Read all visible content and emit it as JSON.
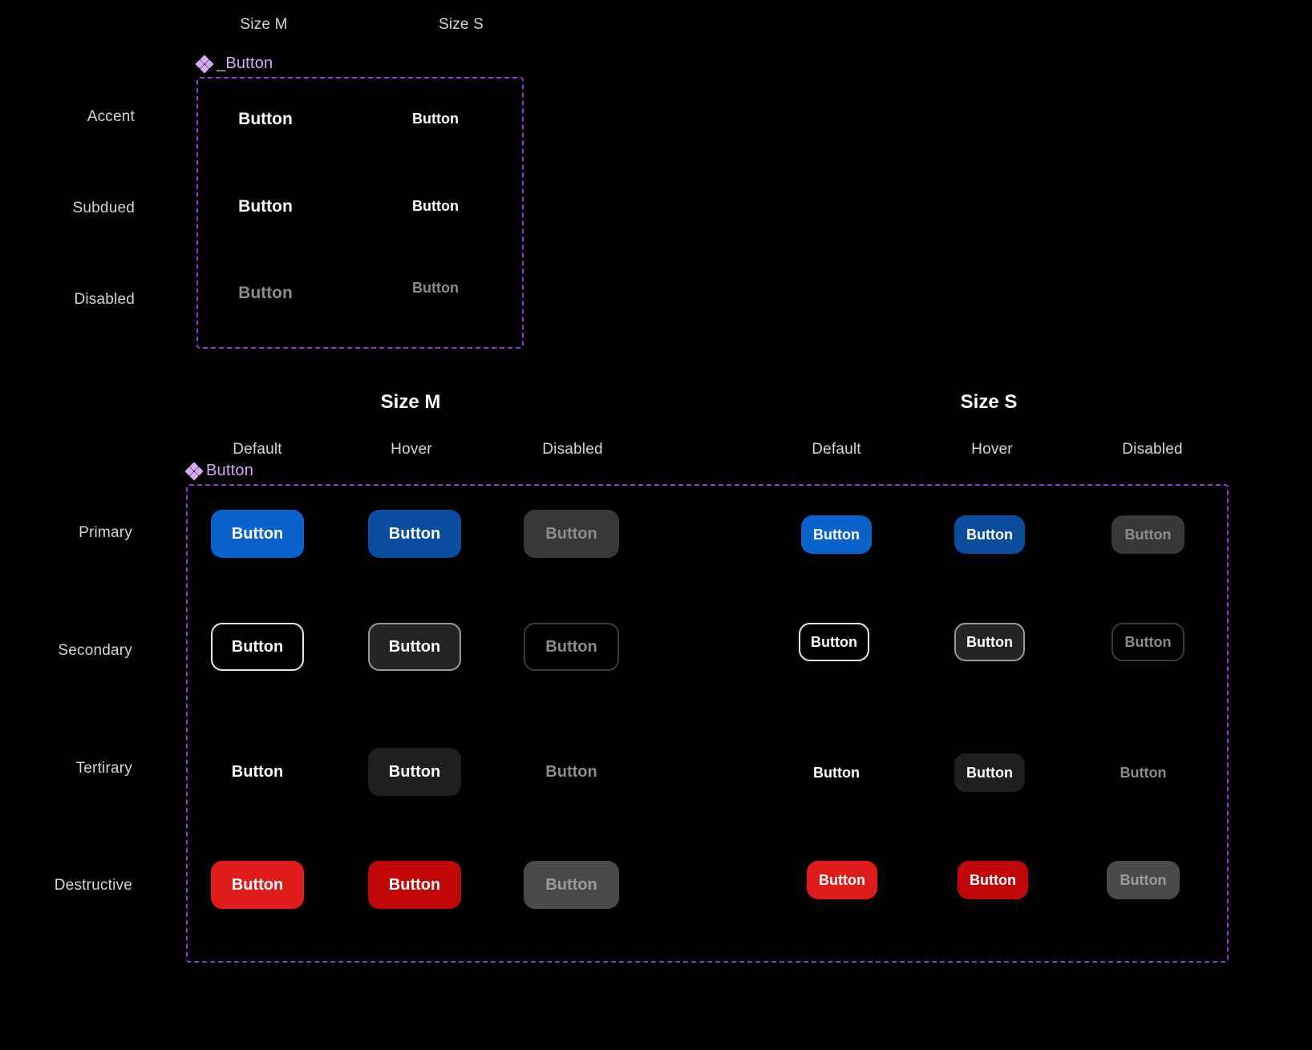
{
  "page": {
    "background": "#000000",
    "accent_purple": "#8b3dd6",
    "component_label_color": "#d7a8f5"
  },
  "top_section": {
    "component_name": "_Button",
    "component_icon": "figma-component-diamond-icon",
    "size_headers": [
      {
        "label": "Size M"
      },
      {
        "label": "Size S"
      }
    ],
    "row_labels": [
      {
        "label": "Accent"
      },
      {
        "label": "Subdued"
      },
      {
        "label": "Disabled"
      }
    ],
    "cells": [
      {
        "row": "Accent",
        "size": "Size M",
        "label": "Button",
        "state": "accent"
      },
      {
        "row": "Accent",
        "size": "Size S",
        "label": "Button",
        "state": "accent"
      },
      {
        "row": "Subdued",
        "size": "Size M",
        "label": "Button",
        "state": "subdued"
      },
      {
        "row": "Subdued",
        "size": "Size S",
        "label": "Button",
        "state": "subdued"
      },
      {
        "row": "Disabled",
        "size": "Size M",
        "label": "Button",
        "state": "disabled"
      },
      {
        "row": "Disabled",
        "size": "Size S",
        "label": "Button",
        "state": "disabled"
      }
    ]
  },
  "bottom_section": {
    "component_name": "Button",
    "component_icon": "figma-component-diamond-icon",
    "size_groups": [
      {
        "title": "Size M",
        "states": [
          "Default",
          "Hover",
          "Disabled"
        ]
      },
      {
        "title": "Size S",
        "states": [
          "Default",
          "Hover",
          "Disabled"
        ]
      }
    ],
    "state_headers": [
      "Default",
      "Hover",
      "Disabled",
      "Default",
      "Hover",
      "Disabled"
    ],
    "row_labels": [
      {
        "label": "Primary"
      },
      {
        "label": "Secondary"
      },
      {
        "label": "Tertirary"
      },
      {
        "label": "Destructive"
      }
    ],
    "button_label": "Button",
    "cells": [
      {
        "row": "Primary",
        "size": "Size M",
        "state": "Default",
        "label": "Button",
        "fill": "#0a63cc",
        "text": "#ffffff"
      },
      {
        "row": "Primary",
        "size": "Size M",
        "state": "Hover",
        "label": "Button",
        "fill": "#0a4c9e",
        "text": "#ffffff"
      },
      {
        "row": "Primary",
        "size": "Size M",
        "state": "Disabled",
        "label": "Button",
        "fill": "#383838",
        "text": "#8c8c8c"
      },
      {
        "row": "Primary",
        "size": "Size S",
        "state": "Default",
        "label": "Button",
        "fill": "#0a63cc",
        "text": "#ffffff"
      },
      {
        "row": "Primary",
        "size": "Size S",
        "state": "Hover",
        "label": "Button",
        "fill": "#0a4c9e",
        "text": "#ffffff"
      },
      {
        "row": "Primary",
        "size": "Size S",
        "state": "Disabled",
        "label": "Button",
        "fill": "#383838",
        "text": "#8c8c8c"
      },
      {
        "row": "Secondary",
        "size": "Size M",
        "state": "Default",
        "label": "Button",
        "fill": "transparent",
        "text": "#ffffff",
        "border": "#e8e8e8"
      },
      {
        "row": "Secondary",
        "size": "Size M",
        "state": "Hover",
        "label": "Button",
        "fill": "#242424",
        "text": "#ffffff",
        "border": "#9a9a9a"
      },
      {
        "row": "Secondary",
        "size": "Size M",
        "state": "Disabled",
        "label": "Button",
        "fill": "transparent",
        "text": "#8c8c8c",
        "border": "#3a3a3a"
      },
      {
        "row": "Secondary",
        "size": "Size S",
        "state": "Default",
        "label": "Button",
        "fill": "transparent",
        "text": "#ffffff",
        "border": "#e8e8e8"
      },
      {
        "row": "Secondary",
        "size": "Size S",
        "state": "Hover",
        "label": "Button",
        "fill": "#242424",
        "text": "#ffffff",
        "border": "#9a9a9a"
      },
      {
        "row": "Secondary",
        "size": "Size S",
        "state": "Disabled",
        "label": "Button",
        "fill": "transparent",
        "text": "#8c8c8c",
        "border": "#3a3a3a"
      },
      {
        "row": "Tertirary",
        "size": "Size M",
        "state": "Default",
        "label": "Button",
        "fill": "transparent",
        "text": "#ffffff"
      },
      {
        "row": "Tertirary",
        "size": "Size M",
        "state": "Hover",
        "label": "Button",
        "fill": "#1f1f1f",
        "text": "#ffffff"
      },
      {
        "row": "Tertirary",
        "size": "Size M",
        "state": "Disabled",
        "label": "Button",
        "fill": "transparent",
        "text": "#8c8c8c"
      },
      {
        "row": "Tertirary",
        "size": "Size S",
        "state": "Default",
        "label": "Button",
        "fill": "transparent",
        "text": "#ffffff"
      },
      {
        "row": "Tertirary",
        "size": "Size S",
        "state": "Hover",
        "label": "Button",
        "fill": "#1f1f1f",
        "text": "#ffffff"
      },
      {
        "row": "Tertirary",
        "size": "Size S",
        "state": "Disabled",
        "label": "Button",
        "fill": "transparent",
        "text": "#8c8c8c"
      },
      {
        "row": "Destructive",
        "size": "Size M",
        "state": "Default",
        "label": "Button",
        "fill": "#e01b1b",
        "text": "#ffffff"
      },
      {
        "row": "Destructive",
        "size": "Size M",
        "state": "Hover",
        "label": "Button",
        "fill": "#c00606",
        "text": "#ffffff"
      },
      {
        "row": "Destructive",
        "size": "Size M",
        "state": "Disabled",
        "label": "Button",
        "fill": "#4a4a4a",
        "text": "#9a9a9a"
      },
      {
        "row": "Destructive",
        "size": "Size S",
        "state": "Default",
        "label": "Button",
        "fill": "#e01b1b",
        "text": "#ffffff"
      },
      {
        "row": "Destructive",
        "size": "Size S",
        "state": "Hover",
        "label": "Button",
        "fill": "#c00606",
        "text": "#ffffff"
      },
      {
        "row": "Destructive",
        "size": "Size S",
        "state": "Disabled",
        "label": "Button",
        "fill": "#4a4a4a",
        "text": "#9a9a9a"
      }
    ]
  }
}
